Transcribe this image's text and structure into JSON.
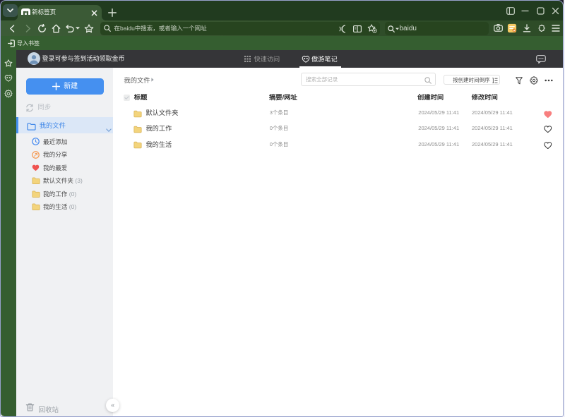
{
  "window": {
    "controls": {
      "layout": "layout-panel",
      "minimize": "minimize",
      "maximize": "maximize",
      "close": "close"
    }
  },
  "browser": {
    "tab": {
      "title": "新标签页"
    },
    "address_bar": {
      "placeholder": "在baidu中搜索，或者输入一个网址"
    },
    "search_box": {
      "value": "baidu"
    },
    "bookmarks_bar": {
      "import_label": "导入书签"
    }
  },
  "notes_header": {
    "login_text": "登录可参与签到活动领取金币",
    "tabs": [
      {
        "label": "快速访问",
        "active": false
      },
      {
        "label": "傲游笔记",
        "active": true
      }
    ]
  },
  "sidebar": {
    "new_button": "新建",
    "sync_label": "同步",
    "root_folder": {
      "label": "我的文件"
    },
    "items": [
      {
        "icon": "clock-icon",
        "label": "最近添加",
        "count": ""
      },
      {
        "icon": "share-icon",
        "label": "我的分享",
        "count": ""
      },
      {
        "icon": "heart-icon",
        "label": "我的最爱",
        "count": ""
      },
      {
        "icon": "folder-icon",
        "label": "默认文件夹",
        "count": " (3)"
      },
      {
        "icon": "folder-icon",
        "label": "我的工作",
        "count": " (0)"
      },
      {
        "icon": "folder-icon",
        "label": "我的生活",
        "count": " (0)"
      }
    ],
    "recycle_bin": "回收站",
    "collapse": "«"
  },
  "content": {
    "breadcrumb": "我的文件",
    "search_placeholder": "搜索全部记录",
    "sort_button": "按创建时间倒序",
    "table": {
      "headers": {
        "title": "标题",
        "summary": "摘要/网址",
        "created": "创建时间",
        "modified": "修改时间"
      },
      "rows": [
        {
          "title": "默认文件夹",
          "summary": "3个条目",
          "created": "2024/05/29 11:41",
          "modified": "2024/05/29 11:41",
          "favorite": true
        },
        {
          "title": "我的工作",
          "summary": "0个条目",
          "created": "2024/05/29 11:41",
          "modified": "2024/05/29 11:41",
          "favorite": false
        },
        {
          "title": "我的生活",
          "summary": "0个条目",
          "created": "2024/05/29 11:41",
          "modified": "2024/05/29 11:41",
          "favorite": false
        }
      ]
    }
  },
  "colors": {
    "chrome_dark": "#213b1f",
    "chrome_light": "#3b5a36",
    "bookmark_bar": "#355e30",
    "field_green": "#27441f",
    "accent_blue": "#4590f0",
    "favorite_red": "#f87f7f",
    "notes_header": "#353538",
    "sidebar_bg": "#f0f1f3",
    "window_border": "#98a1cc"
  }
}
